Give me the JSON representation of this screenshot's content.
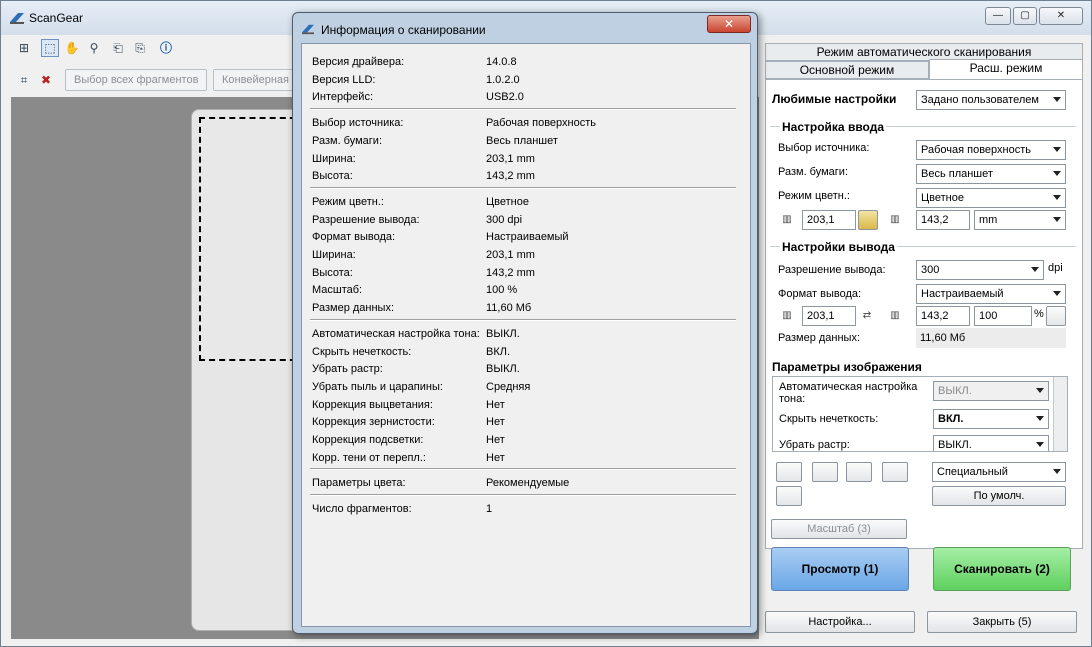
{
  "app": {
    "title": "ScanGear"
  },
  "window_controls": {
    "minimize": "—",
    "maximize": "▢",
    "close": "✕"
  },
  "toolbar2": {
    "select_all": "Выбор всех фрагментов",
    "conveyor": "Конвейерная"
  },
  "right_panel": {
    "tab_auto": "Режим автоматического сканирования",
    "tab_basic": "Основной режим",
    "tab_advanced": "Расш. режим",
    "favorites_label": "Любимые настройки",
    "favorites_value": "Задано пользователем",
    "input_section": "Настройка ввода",
    "source_label": "Выбор источника:",
    "source_value": "Рабочая поверхность",
    "paper_label": "Разм. бумаги:",
    "paper_value": "Весь планшет",
    "color_label": "Режим цветн.:",
    "color_value": "Цветное",
    "in_width": "203,1",
    "in_height": "143,2",
    "unit": "mm",
    "output_section": "Настройки вывода",
    "res_label": "Разрешение вывода:",
    "res_value": "300",
    "dpi": "dpi",
    "format_label": "Формат вывода:",
    "format_value": "Настраиваемый",
    "out_width": "203,1",
    "out_height": "143,2",
    "scale": "100",
    "percent": "%",
    "datasize_label": "Размер данных:",
    "datasize_value": "11,60 Мб",
    "image_section": "Параметры изображения",
    "auto_tone_label": "Автоматическая настройка тона:",
    "auto_tone_value": "ВЫКЛ.",
    "unsharp_label": "Скрыть нечеткость:",
    "unsharp_value": "ВКЛ.",
    "descreen_label": "Убрать растр:",
    "descreen_value": "ВЫКЛ.",
    "preset_value": "Специальный",
    "defaults_button": "По умолч.",
    "zoom_button": "Масштаб (3)",
    "preview_button": "Просмотр (1)",
    "scan_button": "Сканировать (2)",
    "settings_button": "Настройка...",
    "close_button": "Закрыть (5)"
  },
  "dialog": {
    "title": "Информация о сканировании",
    "close": "✕",
    "rows": [
      {
        "k": "Версия драйвера:",
        "v": "14.0.8"
      },
      {
        "k": "Версия LLD:",
        "v": "1.0.2.0"
      },
      {
        "k": "Интерфейс:",
        "v": "USB2.0"
      },
      {
        "k": "Выбор источника:",
        "v": "Рабочая поверхность"
      },
      {
        "k": "Разм. бумаги:",
        "v": "Весь планшет"
      },
      {
        "k": "Ширина:",
        "v": "203,1 mm"
      },
      {
        "k": "Высота:",
        "v": "143,2 mm"
      },
      {
        "k": "Режим цветн.:",
        "v": "Цветное"
      },
      {
        "k": "Разрешение вывода:",
        "v": "300 dpi"
      },
      {
        "k": "Формат вывода:",
        "v": "Настраиваемый"
      },
      {
        "k": "Ширина:",
        "v": "203,1 mm"
      },
      {
        "k": "Высота:",
        "v": "143,2 mm"
      },
      {
        "k": "Масштаб:",
        "v": "100 %"
      },
      {
        "k": "Размер данных:",
        "v": "11,60 Мб"
      },
      {
        "k": "Автоматическая настройка тона:",
        "v": "ВЫКЛ."
      },
      {
        "k": "Скрыть нечеткость:",
        "v": "ВКЛ."
      },
      {
        "k": "Убрать растр:",
        "v": "ВЫКЛ."
      },
      {
        "k": "Убрать пыль и царапины:",
        "v": "Средняя"
      },
      {
        "k": "Коррекция выцветания:",
        "v": "Нет"
      },
      {
        "k": "Коррекция зернистости:",
        "v": "Нет"
      },
      {
        "k": "Коррекция подсветки:",
        "v": "Нет"
      },
      {
        "k": "Корр. тени от перепл.:",
        "v": "Нет"
      },
      {
        "k": "Параметры цвета:",
        "v": "Рекомендуемые"
      },
      {
        "k": "Число фрагментов:",
        "v": "1"
      }
    ]
  }
}
